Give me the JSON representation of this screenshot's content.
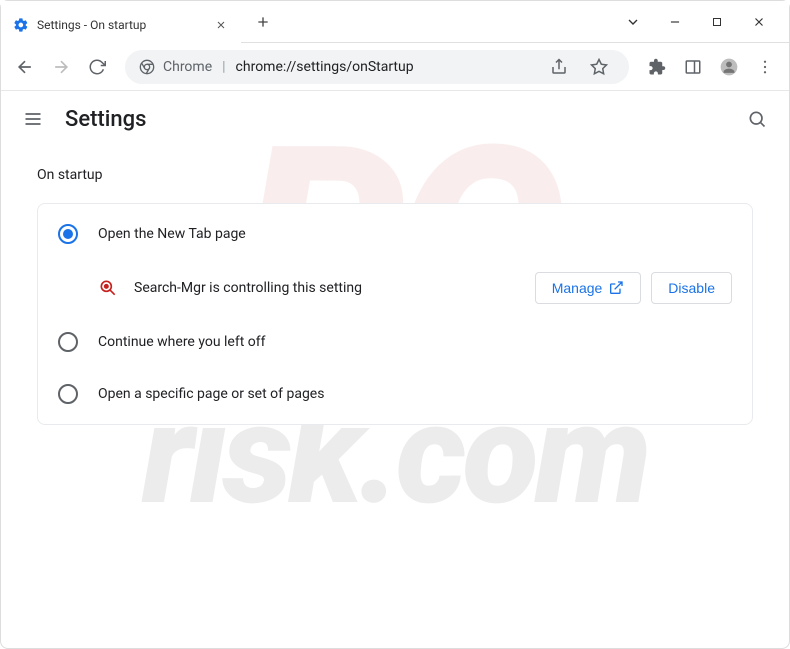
{
  "window": {
    "tab_title": "Settings - On startup"
  },
  "address": {
    "prefix": "Chrome",
    "url": "chrome://settings/onStartup"
  },
  "header": {
    "title": "Settings"
  },
  "section": {
    "title": "On startup",
    "options": {
      "0": {
        "label": "Open the New Tab page",
        "selected": true
      },
      "1": {
        "label": "Continue where you left off",
        "selected": false
      },
      "2": {
        "label": "Open a specific page or set of pages",
        "selected": false
      }
    },
    "notice": {
      "text": "Search-Mgr is controlling this setting",
      "manage_label": "Manage",
      "disable_label": "Disable"
    }
  }
}
